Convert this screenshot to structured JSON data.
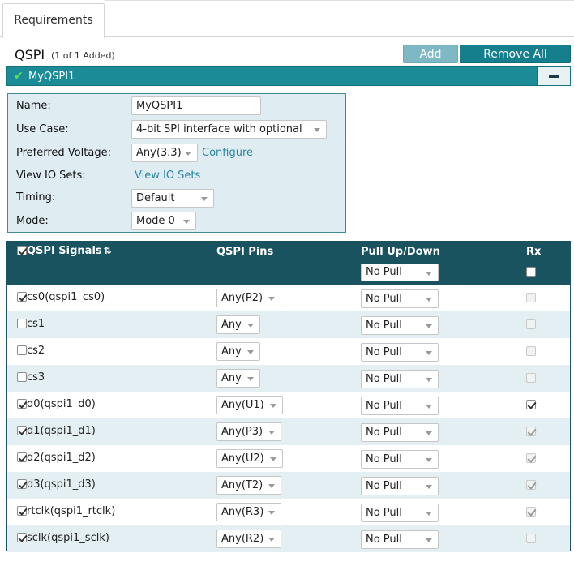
{
  "tab": {
    "label": "Requirements"
  },
  "header": {
    "title": "QSPI",
    "count": "(1 of 1 Added)",
    "add_label": "Add",
    "remove_all_label": "Remove All"
  },
  "instance": {
    "name": "MyQSPI1",
    "status_icon": "check-icon",
    "collapse_icon": "minus-icon"
  },
  "config": {
    "name_label": "Name:",
    "name_value": "MyQSPI1",
    "use_case_label": "Use Case:",
    "use_case_value": "4-bit SPI interface with optional (",
    "voltage_label": "Preferred Voltage:",
    "voltage_value": "Any(3.3)",
    "configure_link": "Configure",
    "io_sets_label": "View IO Sets:",
    "io_sets_link": "View IO Sets",
    "timing_label": "Timing:",
    "timing_value": "Default",
    "mode_label": "Mode:",
    "mode_value": "Mode 0"
  },
  "table": {
    "col_signals": "QSPI Signals",
    "sort_icon": "sort-icon",
    "col_pins": "QSPI Pins",
    "col_pull": "Pull Up/Down",
    "col_rx": "Rx",
    "header_pull_value": "No Pull",
    "rows": [
      {
        "signal": "cs0(qspi1_cs0)",
        "checked": true,
        "pin": "Any(P2)",
        "pull": "No Pull",
        "rx": false,
        "rx_enabled": false
      },
      {
        "signal": "cs1",
        "checked": false,
        "pin": "Any",
        "pull": "No Pull",
        "rx": false,
        "rx_enabled": false
      },
      {
        "signal": "cs2",
        "checked": false,
        "pin": "Any",
        "pull": "No Pull",
        "rx": false,
        "rx_enabled": false
      },
      {
        "signal": "cs3",
        "checked": false,
        "pin": "Any",
        "pull": "No Pull",
        "rx": false,
        "rx_enabled": false
      },
      {
        "signal": "d0(qspi1_d0)",
        "checked": true,
        "pin": "Any(U1)",
        "pull": "No Pull",
        "rx": true,
        "rx_enabled": true
      },
      {
        "signal": "d1(qspi1_d1)",
        "checked": true,
        "pin": "Any(P3)",
        "pull": "No Pull",
        "rx": true,
        "rx_enabled": false
      },
      {
        "signal": "d2(qspi1_d2)",
        "checked": true,
        "pin": "Any(U2)",
        "pull": "No Pull",
        "rx": true,
        "rx_enabled": false
      },
      {
        "signal": "d3(qspi1_d3)",
        "checked": true,
        "pin": "Any(T2)",
        "pull": "No Pull",
        "rx": true,
        "rx_enabled": false
      },
      {
        "signal": "rtclk(qspi1_rtclk)",
        "checked": true,
        "pin": "Any(R3)",
        "pull": "No Pull",
        "rx": true,
        "rx_enabled": false
      },
      {
        "signal": "sclk(qspi1_sclk)",
        "checked": true,
        "pin": "Any(R2)",
        "pull": "No Pull",
        "rx": false,
        "rx_enabled": false
      }
    ]
  }
}
